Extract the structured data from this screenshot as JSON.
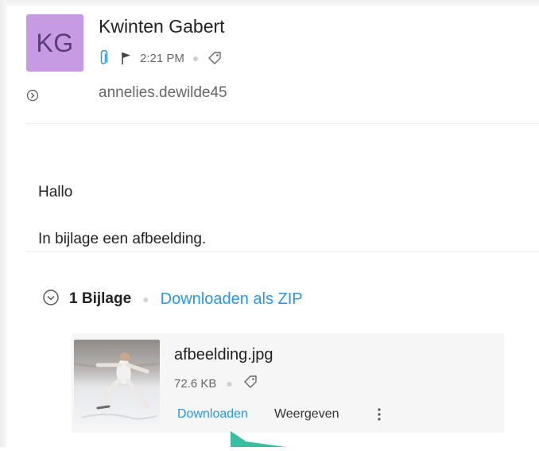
{
  "email": {
    "avatar_initials": "KG",
    "sender_name": "Kwinten Gabert",
    "time": "2:21 PM",
    "recipient": "annelies.dewilde45",
    "greeting": "Hallo",
    "body": "In bijlage een afbeelding."
  },
  "attachments": {
    "count_label": "1 Bijlage",
    "download_zip_label": "Downloaden als ZIP",
    "items": [
      {
        "filename": "afbeelding.jpg",
        "size": "72.6 KB",
        "download_label": "Downloaden",
        "view_label": "Weergeven"
      }
    ]
  },
  "icons": {
    "attachment": "paperclip-icon",
    "flag": "flag-icon",
    "tag": "tag-icon",
    "expand_details": "chevron-right-circle-icon",
    "collapse_attachments": "chevron-down-circle-icon",
    "more": "more-vertical-icon",
    "pointer": "arrow-pointer"
  },
  "colors": {
    "avatar_bg": "#c79be4",
    "link": "#2d96de",
    "paperclip": "#2d96de",
    "pointer": "#3bbfa3"
  }
}
